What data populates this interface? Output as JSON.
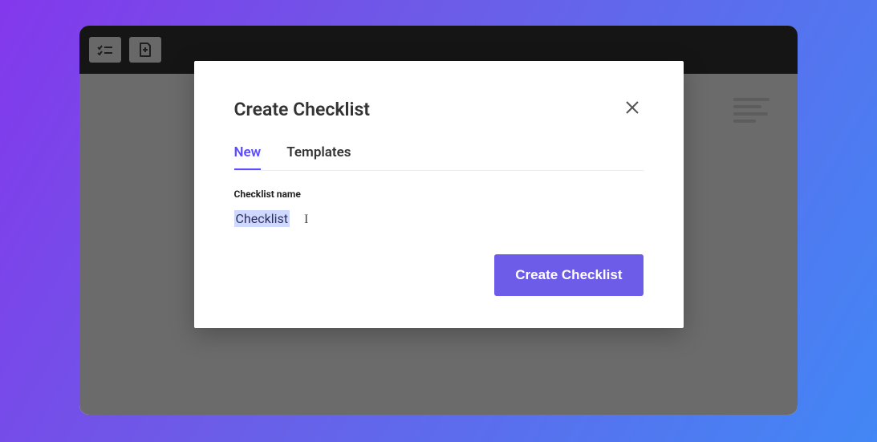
{
  "modal": {
    "title": "Create Checklist",
    "tabs": {
      "new": "New",
      "templates": "Templates"
    },
    "field_label": "Checklist name",
    "input_value": "Checklist",
    "submit_label": "Create Checklist"
  },
  "colors": {
    "accent": "#6c5ce7"
  }
}
